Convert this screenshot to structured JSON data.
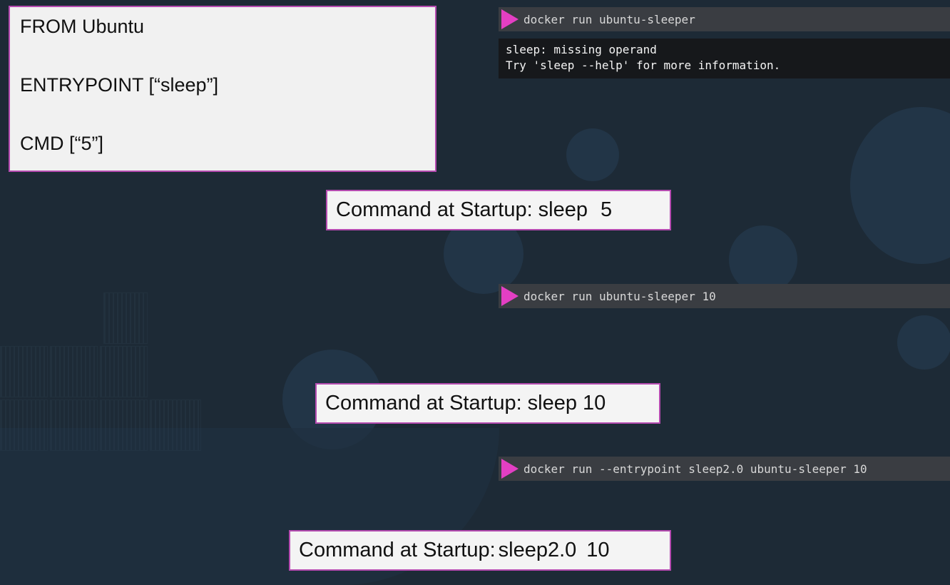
{
  "dockerfile": {
    "lines": [
      "FROM Ubuntu",
      "ENTRYPOINT [“sleep”]",
      "CMD [“5”]"
    ]
  },
  "terminals": [
    {
      "command": "docker run ubuntu-sleeper",
      "output": [
        "sleep: missing operand",
        "Try 'sleep --help' for more information."
      ]
    },
    {
      "command": "docker run ubuntu-sleeper 10"
    },
    {
      "command": "docker run --entrypoint sleep2.0 ubuntu-sleeper 10"
    }
  ],
  "startup_boxes": [
    {
      "label": "Command at Startup:",
      "value": "sleep",
      "arg": "5"
    },
    {
      "label": "Command at Startup:",
      "value": "sleep 10"
    },
    {
      "label": "Command at Startup:",
      "value": "sleep2.0",
      "arg": "10"
    }
  ],
  "colors": {
    "prompt": "#e33fc3",
    "border": "#b54bb0",
    "background": "#1d2a36"
  }
}
